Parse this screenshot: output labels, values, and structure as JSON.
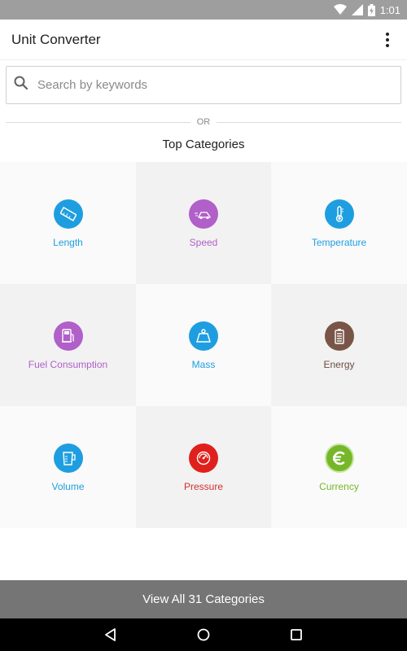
{
  "status_bar": {
    "time": "1:01",
    "icons": [
      "wifi-icon",
      "signal-icon",
      "battery-charging-icon"
    ],
    "background": "#9e9e9e"
  },
  "app_bar": {
    "title": "Unit Converter",
    "menu_icon": "overflow-menu-icon"
  },
  "search": {
    "placeholder": "Search by keywords",
    "value": "",
    "icon": "search-icon"
  },
  "divider": {
    "label": "OR"
  },
  "section": {
    "title": "Top Categories"
  },
  "categories": [
    {
      "label": "Length",
      "icon": "ruler-icon",
      "color": "#1e9ee0"
    },
    {
      "label": "Speed",
      "icon": "car-speed-icon",
      "color": "#b15fc9"
    },
    {
      "label": "Temperature",
      "icon": "thermometer-icon",
      "color": "#1e9ee0"
    },
    {
      "label": "Fuel Consumption",
      "icon": "fuel-pump-icon",
      "color": "#b15fc9"
    },
    {
      "label": "Mass",
      "icon": "weight-icon",
      "color": "#1e9ee0"
    },
    {
      "label": "Energy",
      "icon": "battery-icon",
      "color": "#795548"
    },
    {
      "label": "Volume",
      "icon": "measuring-cup-icon",
      "color": "#1e9ee0"
    },
    {
      "label": "Pressure",
      "icon": "gauge-icon",
      "color": "#e0201c"
    },
    {
      "label": "Currency",
      "icon": "euro-icon",
      "color": "#76b72a"
    }
  ],
  "footer": {
    "view_all_label": "View All 31 Categories",
    "background": "#757575"
  },
  "nav_bar": {
    "buttons": [
      "back-icon",
      "home-icon",
      "recents-icon"
    ]
  }
}
